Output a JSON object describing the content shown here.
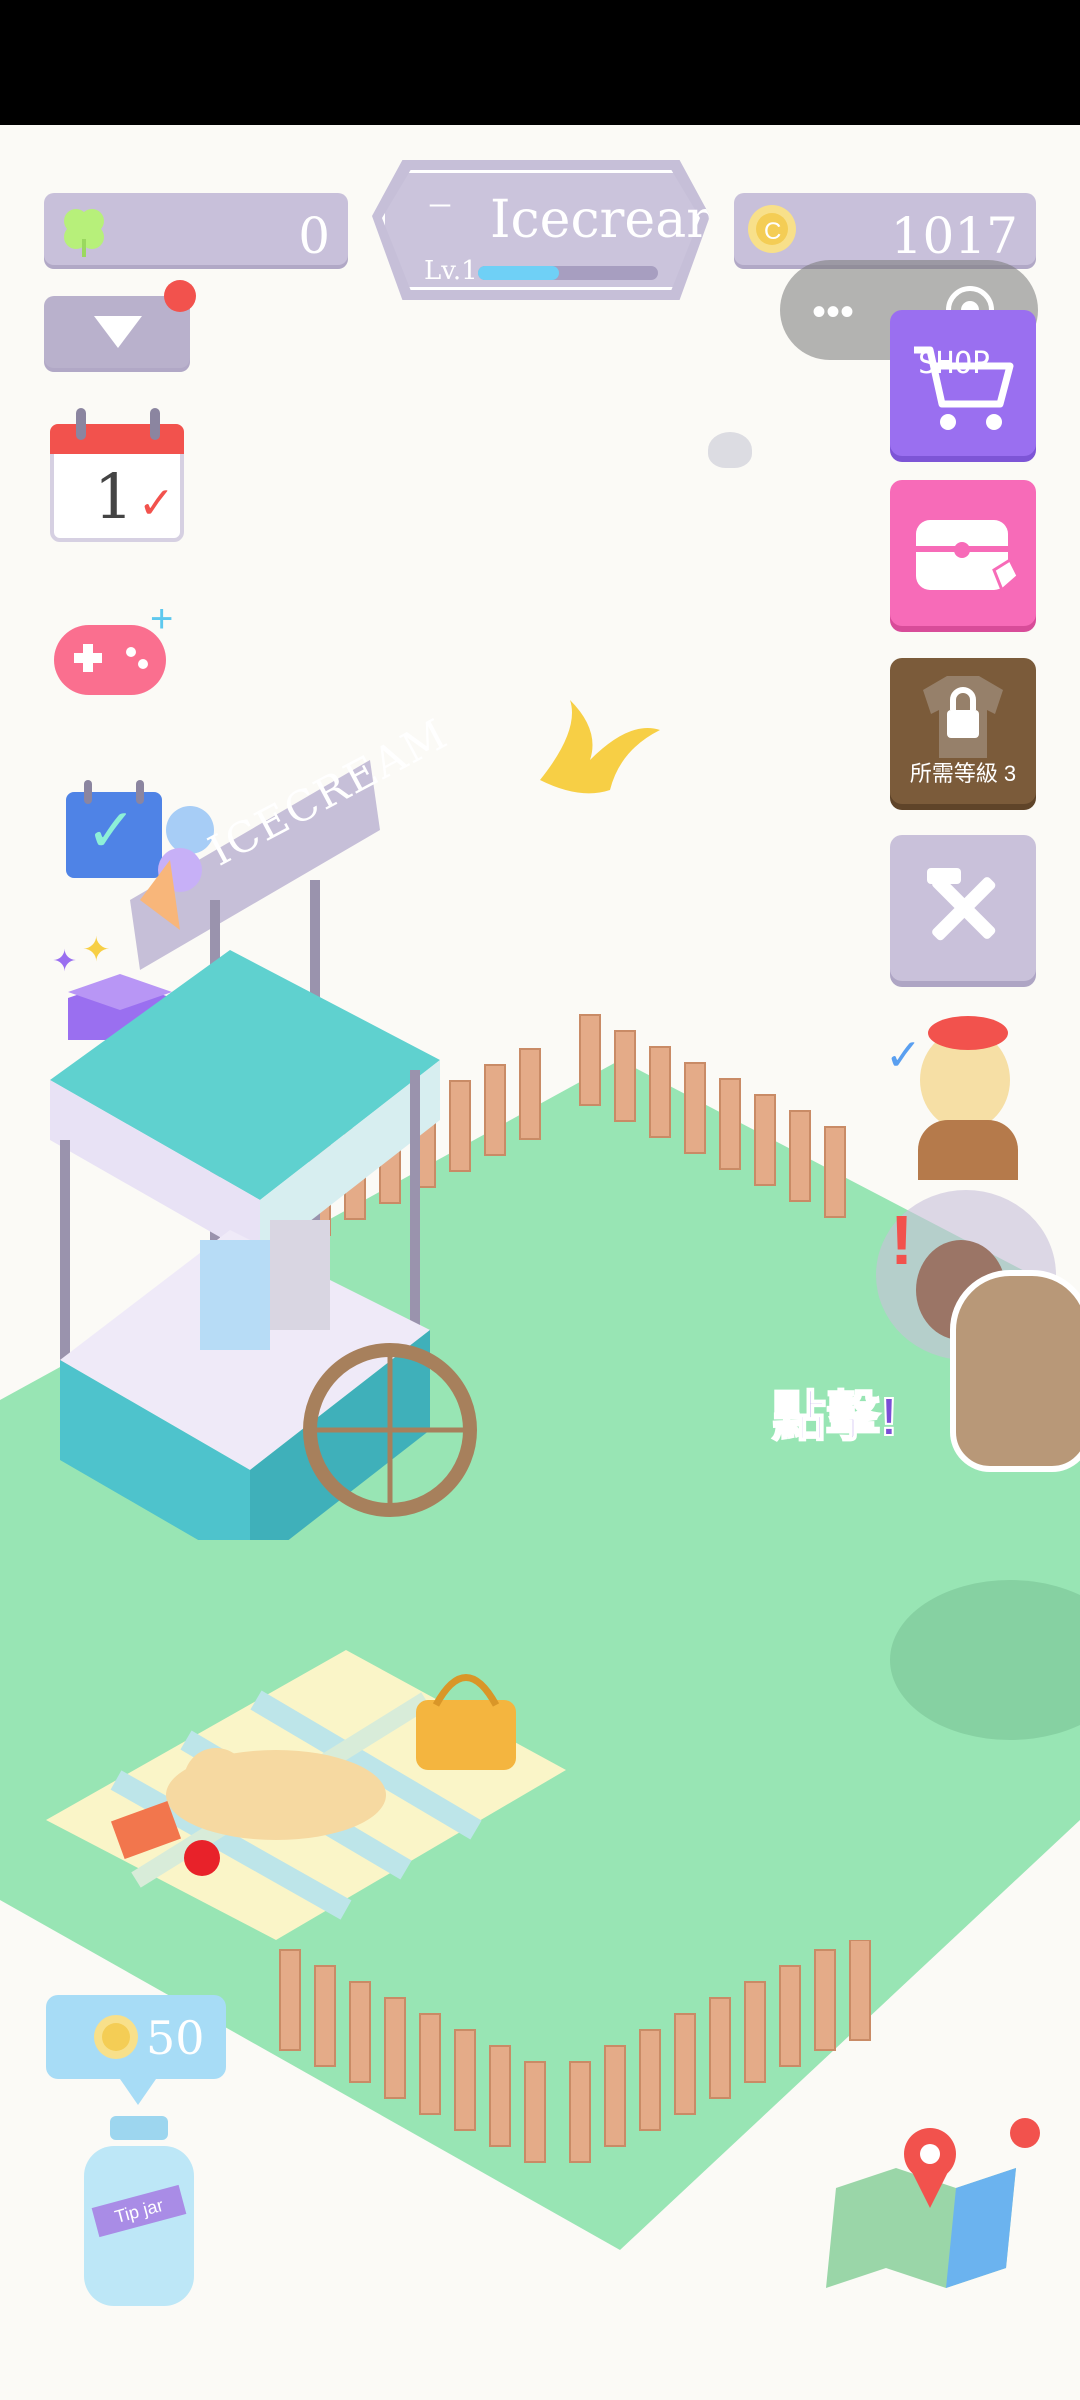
{
  "hud": {
    "clover_count": "0",
    "coin_count": "1017",
    "shop_name": "Icecream",
    "level_label": "Lv.1",
    "level_progress": 0.45,
    "dash": "–"
  },
  "buttons": {
    "shop_label": "SHOP",
    "locked_label": "所需等級 3",
    "tap_hint": "點擊!"
  },
  "calendar": {
    "day": "1"
  },
  "cart": {
    "sign": "ICECREAM"
  },
  "tip_jar": {
    "amount": "50",
    "label": "Tip jar"
  },
  "colors": {
    "grass": "#98e5b4",
    "hud_pill": "#c8c0da",
    "shop_button": "#9a6ff0",
    "treasure_button": "#f76bb8",
    "locked_button": "#7b5b3a",
    "tools_button": "#c9c1da",
    "accent_text": "#7a4fd6"
  },
  "icons": [
    "clover-icon",
    "coin-icon",
    "dropdown-icon",
    "calendar-icon",
    "gamepad-icon",
    "checklist-icon",
    "gift-box-icon",
    "shop-cart-icon",
    "treasure-chest-icon",
    "lock-icon",
    "tools-icon",
    "map-icon",
    "more-icon",
    "record-icon"
  ]
}
